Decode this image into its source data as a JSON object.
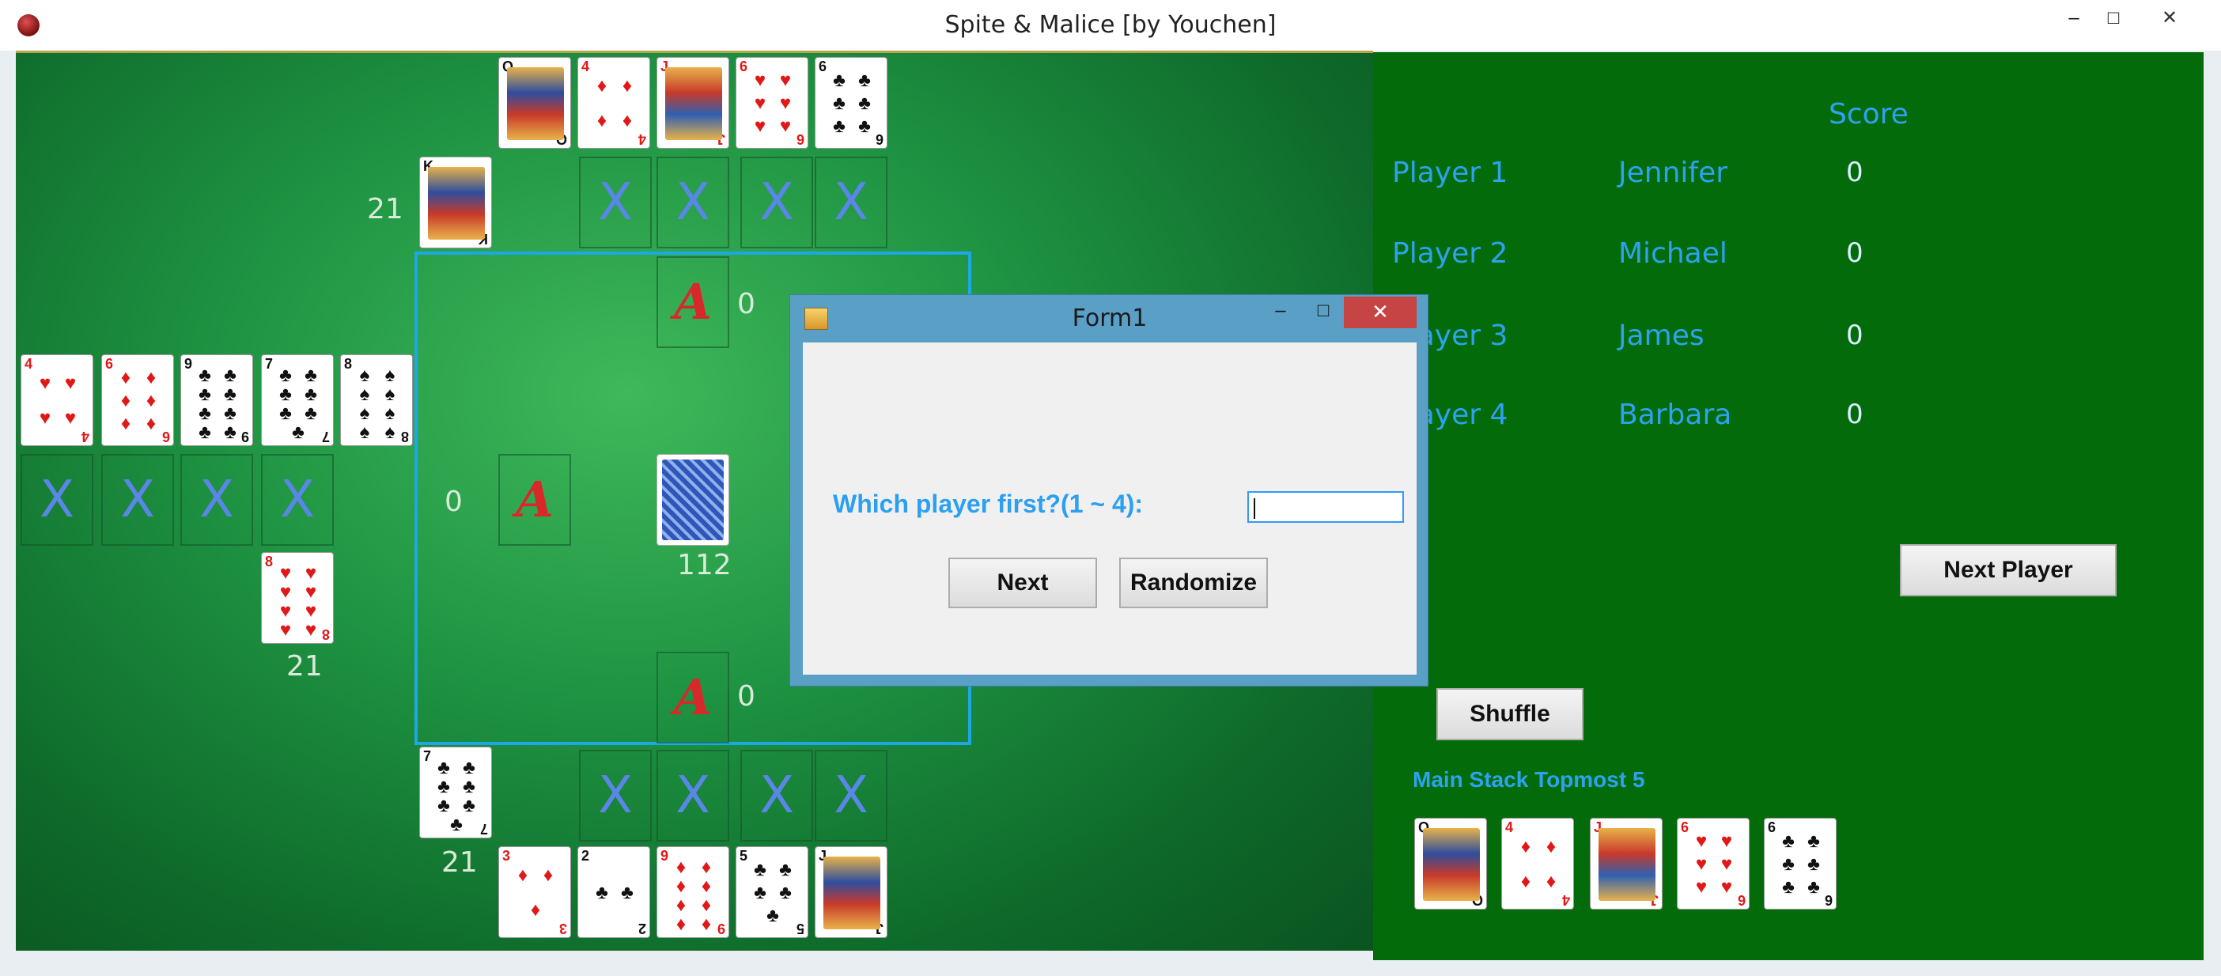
{
  "window": {
    "title": "Spite & Malice [by Youchen]",
    "minimize": "–",
    "maximize": "□",
    "close": "✕"
  },
  "scoreboard": {
    "score_header": "Score",
    "players": [
      {
        "label": "Player 1",
        "name": "Jennifer",
        "score": "0"
      },
      {
        "label": "Player 2",
        "name": "Michael",
        "score": "0"
      },
      {
        "label": "Player 3",
        "name": "James",
        "score": "0"
      },
      {
        "label": "Player 4",
        "name": "Barbara",
        "score": "0"
      }
    ],
    "next_player_label": "Next Player",
    "shuffle_label": "Shuffle",
    "main_stack_label": "Main Stack Topmost 5",
    "main_stack": [
      {
        "rank": "Q",
        "suit": "♣",
        "color": "blk"
      },
      {
        "rank": "4",
        "suit": "♦",
        "color": "red"
      },
      {
        "rank": "J",
        "suit": "♦",
        "color": "red"
      },
      {
        "rank": "6",
        "suit": "♥",
        "color": "red"
      },
      {
        "rank": "6",
        "suit": "♣",
        "color": "blk"
      }
    ]
  },
  "board": {
    "top_hand": [
      {
        "rank": "Q",
        "suit": "♣",
        "color": "blk"
      },
      {
        "rank": "4",
        "suit": "♦",
        "color": "red"
      },
      {
        "rank": "J",
        "suit": "♦",
        "color": "red"
      },
      {
        "rank": "6",
        "suit": "♥",
        "color": "red"
      },
      {
        "rank": "6",
        "suit": "♣",
        "color": "blk"
      }
    ],
    "top_stock": {
      "rank": "K",
      "suit": "♣",
      "color": "blk",
      "count": "21"
    },
    "left_hand": [
      {
        "rank": "4",
        "suit": "♥",
        "color": "red"
      },
      {
        "rank": "6",
        "suit": "♦",
        "color": "red"
      },
      {
        "rank": "9",
        "suit": "♣",
        "color": "blk"
      },
      {
        "rank": "7",
        "suit": "♣",
        "color": "blk"
      },
      {
        "rank": "8",
        "suit": "♠",
        "color": "blk"
      }
    ],
    "left_stock": {
      "rank": "8",
      "suit": "♥",
      "color": "red",
      "count": "21"
    },
    "bottom_hand": [
      {
        "rank": "3",
        "suit": "♦",
        "color": "red"
      },
      {
        "rank": "2",
        "suit": "♣",
        "color": "blk"
      },
      {
        "rank": "9",
        "suit": "♦",
        "color": "red"
      },
      {
        "rank": "5",
        "suit": "♣",
        "color": "blk"
      },
      {
        "rank": "J",
        "suit": "♣",
        "color": "blk"
      }
    ],
    "bottom_stock": {
      "rank": "7",
      "suit": "♣",
      "color": "blk",
      "count": "21"
    },
    "discard_marker": "X",
    "build_marker": "A",
    "build_counts": {
      "top": "0",
      "left": "0",
      "bottom": "0"
    },
    "deck_count": "112"
  },
  "dialog": {
    "title": "Form1",
    "question": "Which player first?(1 ~ 4):",
    "input_value": "",
    "next_label": "Next",
    "randomize_label": "Randomize",
    "minimize": "–",
    "maximize": "□",
    "close": "✕"
  },
  "colors": {
    "felt": "#1f9443",
    "panel": "#046b0a",
    "accent": "#2ca2f0",
    "build_box": "#1ea7e6"
  }
}
